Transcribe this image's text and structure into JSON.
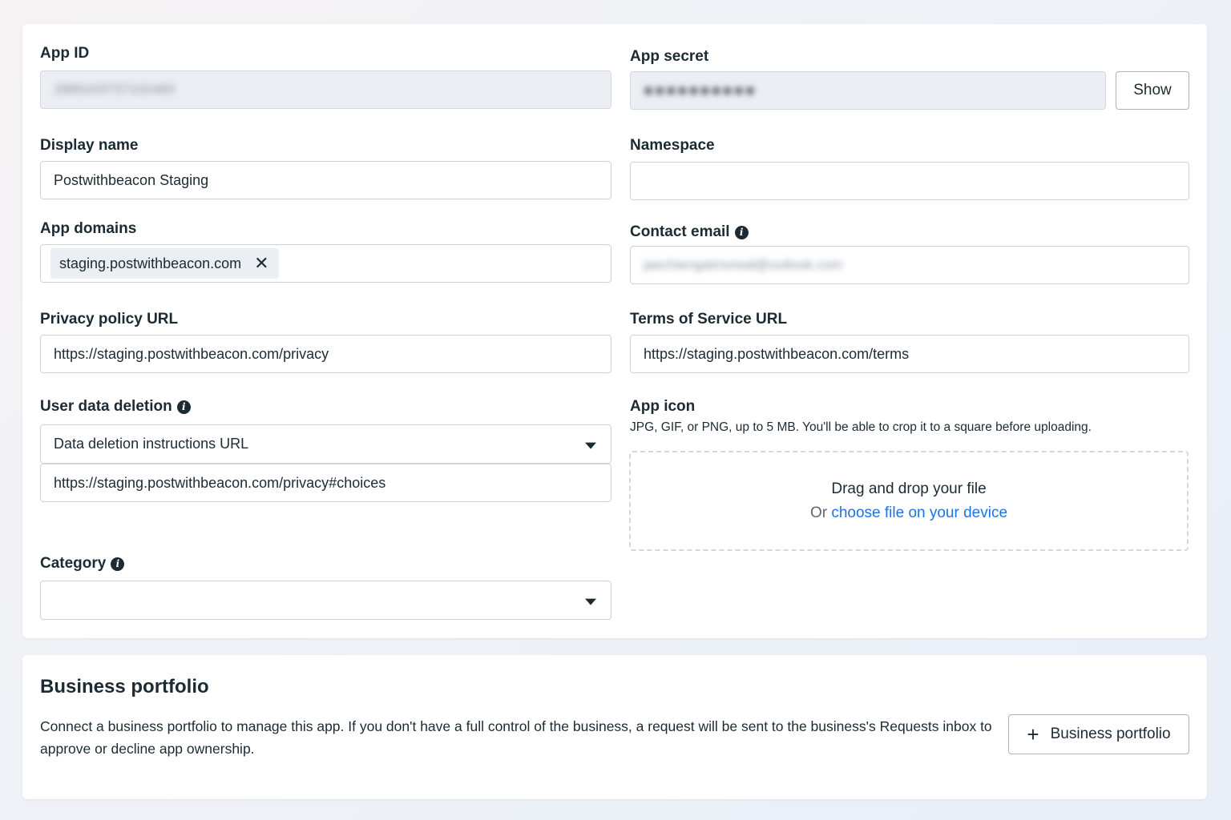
{
  "basic_settings": {
    "app_id": {
      "label": "App ID",
      "value": "2889103737102460"
    },
    "app_secret": {
      "label": "App secret",
      "value": "●●●●●●●●●●",
      "show_button": "Show"
    },
    "display_name": {
      "label": "Display name",
      "value": "Postwithbeacon Staging"
    },
    "namespace": {
      "label": "Namespace",
      "value": ""
    },
    "app_domains": {
      "label": "App domains",
      "chips": [
        "staging.postwithbeacon.com"
      ],
      "remove_icon": "close-icon"
    },
    "contact_email": {
      "label": "Contact email",
      "value": "jaechiengatmoreal@outlook.com",
      "info_icon": "info-icon"
    },
    "privacy_policy_url": {
      "label": "Privacy policy URL",
      "value": "https://staging.postwithbeacon.com/privacy"
    },
    "terms_of_service_url": {
      "label": "Terms of Service URL",
      "value": "https://staging.postwithbeacon.com/terms"
    },
    "user_data_deletion": {
      "label": "User data deletion",
      "selected_option": "Data deletion instructions URL",
      "url_value": "https://staging.postwithbeacon.com/privacy#choices"
    },
    "app_icon": {
      "label": "App icon",
      "helper": "JPG, GIF, or PNG, up to 5 MB. You'll be able to crop it to a square before uploading.",
      "dropzone_title": "Drag and drop your file",
      "dropzone_or": "Or",
      "dropzone_link": "choose file on your device"
    },
    "category": {
      "label": "Category",
      "selected_option": ""
    }
  },
  "business_portfolio": {
    "title": "Business portfolio",
    "description": "Connect a business portfolio to manage this app. If you don't have a full control of the business, a request will be sent to the business's Requests inbox to approve or decline app ownership.",
    "button_label": "Business portfolio",
    "button_icon": "plus-icon"
  },
  "colors": {
    "link": "#1b74e4",
    "text": "#1c2b33",
    "readonly_bg": "#ebeef2",
    "border": "#cbd2d9"
  }
}
